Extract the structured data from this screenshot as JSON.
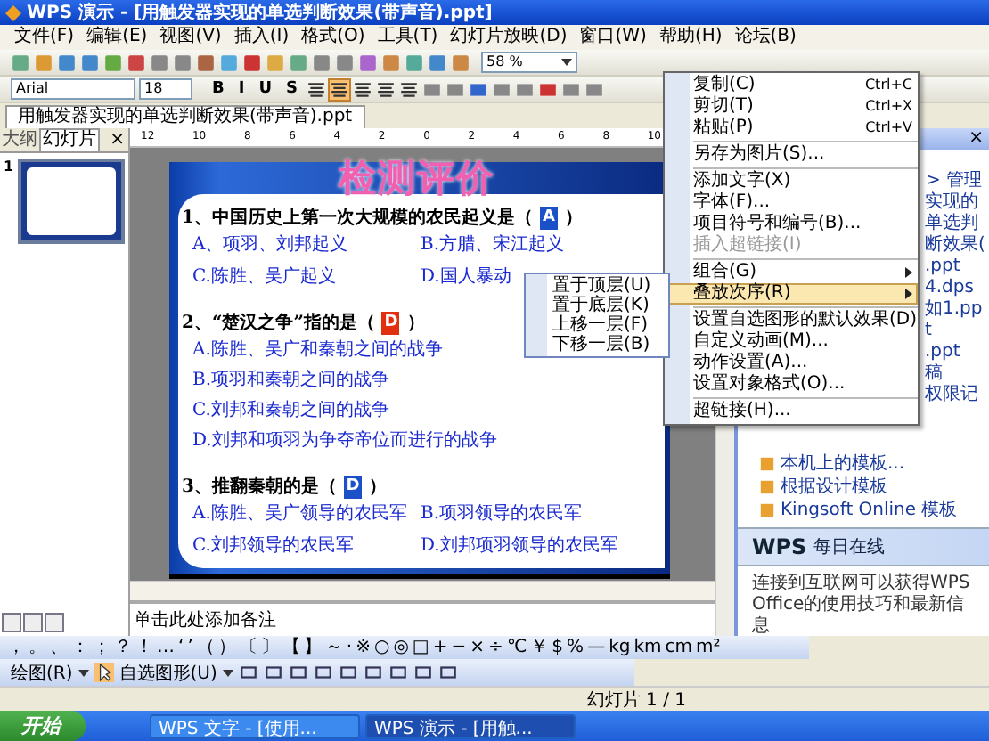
{
  "window": {
    "title": "WPS 演示 - [用触发器实现的单选判断效果(带声音).ppt]"
  },
  "menu_bar": [
    {
      "label": "文件(F)"
    },
    {
      "label": "编辑(E)"
    },
    {
      "label": "视图(V)"
    },
    {
      "label": "插入(I)"
    },
    {
      "label": "格式(O)"
    },
    {
      "label": "工具(T)"
    },
    {
      "label": "幻灯片放映(D)"
    },
    {
      "label": "窗口(W)"
    },
    {
      "label": "帮助(H)"
    },
    {
      "label": "论坛(B)"
    }
  ],
  "standard_toolbar": {
    "zoom": "58 %"
  },
  "format_toolbar": {
    "font": "Arial",
    "size": "18",
    "styles": [
      {
        "label": "B",
        "on": false
      },
      {
        "label": "I",
        "on": false
      },
      {
        "label": "U",
        "on": false
      },
      {
        "label": "S",
        "on": false
      }
    ],
    "alignment": [
      {
        "selected": false
      },
      {
        "selected": true
      },
      {
        "selected": false
      },
      {
        "selected": false
      },
      {
        "selected": false
      }
    ]
  },
  "doc_tab": {
    "label": "用触发器实现的单选判断效果(带声音).ppt"
  },
  "side_panel": {
    "tabs": [
      {
        "label": "大纲",
        "selected": false
      },
      {
        "label": "幻灯片",
        "selected": true
      }
    ],
    "close": "×",
    "slides": [
      {
        "number": "1",
        "selected": true
      }
    ]
  },
  "ruler": {
    "labels": [
      "12",
      "10",
      "8",
      "6",
      "4",
      "2",
      "0",
      "2",
      "4",
      "6",
      "8",
      "10"
    ]
  },
  "slide": {
    "title": "检测评价",
    "questions": [
      {
        "text": "1、中国历史上第一次大规模的农民起义是（",
        "answer": "A",
        "color": "#1c50c8",
        "close": "）",
        "kind": "grid",
        "options": [
          "A、项羽、刘邦起义",
          "B.方腊、宋江起义",
          "C.陈胜、吴广起义",
          "D.国人暴动"
        ]
      },
      {
        "text": "2、“楚汉之争”指的是（",
        "answer": "D",
        "color": "#e03010",
        "close": "）",
        "kind": "list",
        "options": [
          "A.陈胜、吴广和秦朝之间的战争",
          "B.项羽和秦朝之间的战争",
          "C.刘邦和秦朝之间的战争",
          "D.刘邦和项羽为争夺帝位而进行的战争"
        ]
      },
      {
        "text": "3、推翻秦朝的是（",
        "answer": "D",
        "color": "#1c50c8",
        "close": "）",
        "kind": "grid",
        "options": [
          "A.陈胜、吴广领导的农民军",
          "B.项羽领导的农民军",
          "C.刘邦领导的农民军",
          "D.刘邦项羽领导的农民军"
        ]
      }
    ]
  },
  "notes": {
    "placeholder": "单击此处添加备注"
  },
  "task_pane": {
    "close": "×",
    "manage": "> 管理",
    "recent": [
      "实现的单选判断效果(",
      ".ppt",
      "4.dps",
      "如1.ppt",
      ".ppt"
    ],
    "partial": [
      "稿",
      "权限记"
    ],
    "links": [
      "本机上的模板...",
      "根据设计模板",
      "Kingsoft Online 模板"
    ],
    "banner": {
      "logo": "WPS",
      "label": "每日在线"
    },
    "info": "连接到互联网可以获得WPS Office的使用技巧和最新信息"
  },
  "context_menu": {
    "items": [
      {
        "kind": "item",
        "label": "复制(C)",
        "shortcut": "Ctrl+C",
        "disabled": false,
        "selected": false,
        "submenu": false
      },
      {
        "kind": "item",
        "label": "剪切(T)",
        "shortcut": "Ctrl+X",
        "disabled": false,
        "selected": false,
        "submenu": false
      },
      {
        "kind": "item",
        "label": "粘贴(P)",
        "shortcut": "Ctrl+V",
        "disabled": false,
        "selected": false,
        "submenu": false
      },
      {
        "kind": "separator"
      },
      {
        "kind": "item",
        "label": "另存为图片(S)...",
        "disabled": false,
        "selected": false,
        "submenu": false
      },
      {
        "kind": "separator"
      },
      {
        "kind": "item",
        "label": "添加文字(X)",
        "disabled": false,
        "selected": false,
        "submenu": false
      },
      {
        "kind": "item",
        "label": "字体(F)...",
        "disabled": false,
        "selected": false,
        "submenu": false
      },
      {
        "kind": "item",
        "label": "项目符号和编号(B)...",
        "disabled": false,
        "selected": false,
        "submenu": false
      },
      {
        "kind": "item",
        "label": "插入超链接(I)",
        "disabled": true,
        "selected": false,
        "submenu": false
      },
      {
        "kind": "separator"
      },
      {
        "kind": "item",
        "label": "组合(G)",
        "disabled": false,
        "selected": false,
        "submenu": true
      },
      {
        "kind": "item",
        "label": "叠放次序(R)",
        "disabled": false,
        "selected": true,
        "submenu": true
      },
      {
        "kind": "separator"
      },
      {
        "kind": "item",
        "label": "设置自选图形的默认效果(D)",
        "disabled": false,
        "selected": false,
        "submenu": false
      },
      {
        "kind": "item",
        "label": "自定义动画(M)...",
        "disabled": false,
        "selected": false,
        "submenu": false
      },
      {
        "kind": "item",
        "label": "动作设置(A)...",
        "disabled": false,
        "selected": false,
        "submenu": false
      },
      {
        "kind": "item",
        "label": "设置对象格式(O)...",
        "disabled": false,
        "selected": false,
        "submenu": false
      },
      {
        "kind": "separator"
      },
      {
        "kind": "item",
        "label": "超链接(H)...",
        "disabled": false,
        "selected": false,
        "submenu": false
      }
    ]
  },
  "submenu": {
    "items": [
      {
        "label": "置于顶层(U)"
      },
      {
        "label": "置于底层(K)"
      },
      {
        "label": "上移一层(F)"
      },
      {
        "label": "下移一层(B)"
      }
    ]
  },
  "symbol_toolbar": {
    "symbols": [
      "，",
      "。",
      "、",
      "：",
      "；",
      "？",
      "！",
      "…",
      "‘",
      "’",
      "（",
      "）",
      "〔",
      "〕",
      "【",
      "】",
      "～",
      "·",
      "※",
      "○",
      "◎",
      "□",
      "+",
      "−",
      "×",
      "÷",
      "℃",
      "￥",
      "$",
      "%",
      "—",
      "kg",
      "km",
      "cm",
      "m²"
    ]
  },
  "drawing_toolbar": {
    "draw": "绘图(R)",
    "autoshapes": "自选图形(U)"
  },
  "status_bar": {
    "slide": "幻灯片 1 / 1"
  },
  "taskbar": {
    "start": "开始",
    "tasks": [
      {
        "label": "WPS 文字 - [使用...",
        "selected": false
      },
      {
        "label": "WPS 演示 - [用触...",
        "selected": true
      }
    ]
  }
}
